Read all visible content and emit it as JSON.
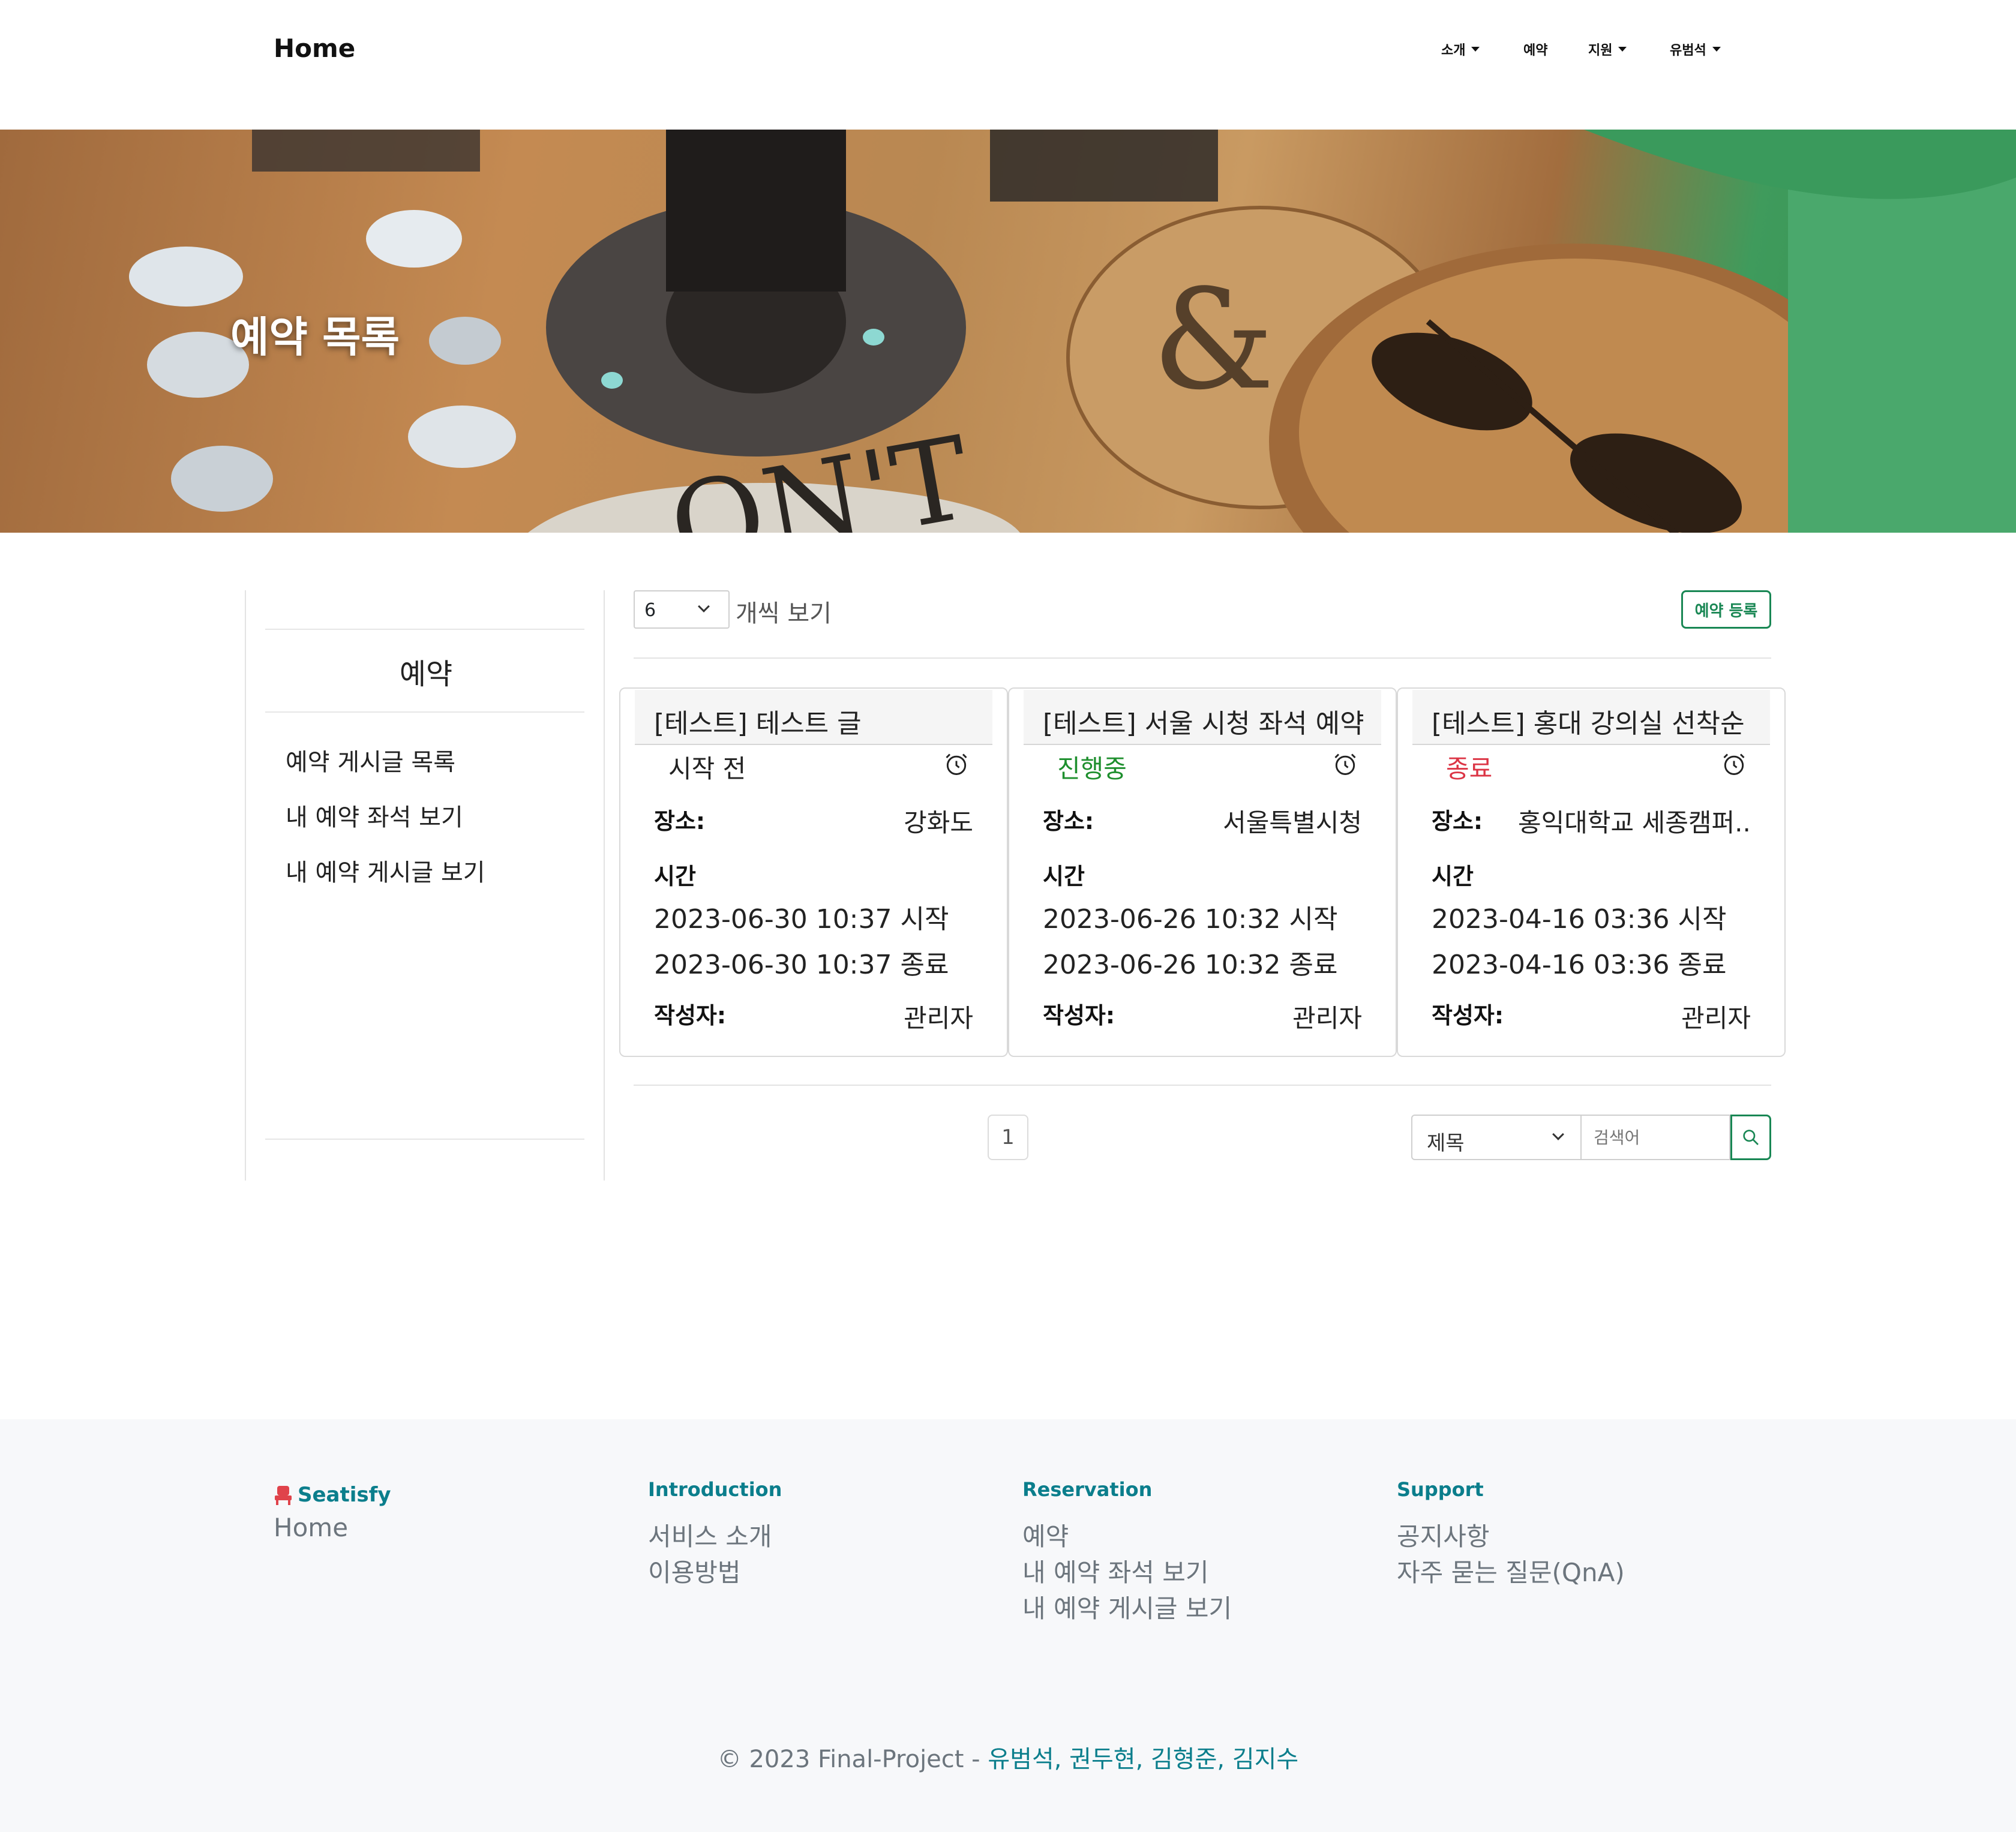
{
  "nav": {
    "brand": "Home",
    "items": [
      {
        "label": "소개",
        "dropdown": true
      },
      {
        "label": "예약",
        "dropdown": false
      },
      {
        "label": "지원",
        "dropdown": true
      },
      {
        "label": "유범석",
        "dropdown": true
      }
    ]
  },
  "hero": {
    "title": "예약 목록"
  },
  "sidebar": {
    "title": "예약",
    "links": [
      "예약 게시글 목록",
      "내 예약 좌석 보기",
      "내 예약 게시글 보기"
    ]
  },
  "toolbar": {
    "per_page_value": "6",
    "per_page_label": "개씩 보기",
    "add_button": "예약 등록"
  },
  "cards": [
    {
      "title": "[테스트] 테스트 글",
      "status": "시작 전",
      "status_color": "#222222",
      "place_label": "장소:",
      "place": "강화도",
      "time_label": "시간",
      "start": "2023-06-30 10:37 시작",
      "end": "2023-06-30 10:37 종료",
      "author_label": "작성자:",
      "author": "관리자"
    },
    {
      "title": "[테스트] 서울 시청 좌석 예약",
      "status": "진행중",
      "status_color": "#1e8f2e",
      "place_label": "장소:",
      "place": "서울특별시청",
      "time_label": "시간",
      "start": "2023-06-26 10:32 시작",
      "end": "2023-06-26 10:32 종료",
      "author_label": "작성자:",
      "author": "관리자"
    },
    {
      "title": "[테스트] 홍대 강의실 선착순",
      "status": "종료",
      "status_color": "#dc3545",
      "place_label": "장소:",
      "place": "홍익대학교 세종캠퍼...",
      "time_label": "시간",
      "start": "2023-04-16 03:36 시작",
      "end": "2023-04-16 03:36 종료",
      "author_label": "작성자:",
      "author": "관리자"
    }
  ],
  "pagination": {
    "current": "1"
  },
  "search": {
    "field": "제목",
    "placeholder": "검색어"
  },
  "footer": {
    "brand": "Seatisfy",
    "home_link": "Home",
    "columns": [
      {
        "heading": "Introduction",
        "links": [
          "서비스 소개",
          "이용방법"
        ]
      },
      {
        "heading": "Reservation",
        "links": [
          "예약",
          "내 예약 좌석 보기",
          "내 예약 게시글 보기"
        ]
      },
      {
        "heading": "Support",
        "links": [
          "공지사항",
          "자주 묻는 질문(QnA)"
        ]
      }
    ],
    "copyright": "© 2023 Final-Project - ",
    "authors": "유범석, 권두현, 김형준, 김지수"
  },
  "colors": {
    "accent": "#198754",
    "footer_heading": "#0b7e8c",
    "brand_icon": "#e0434b"
  },
  "icons": [
    "caret-down-icon",
    "alarm-clock-icon",
    "chevron-down-icon",
    "search-icon",
    "seat-icon"
  ]
}
